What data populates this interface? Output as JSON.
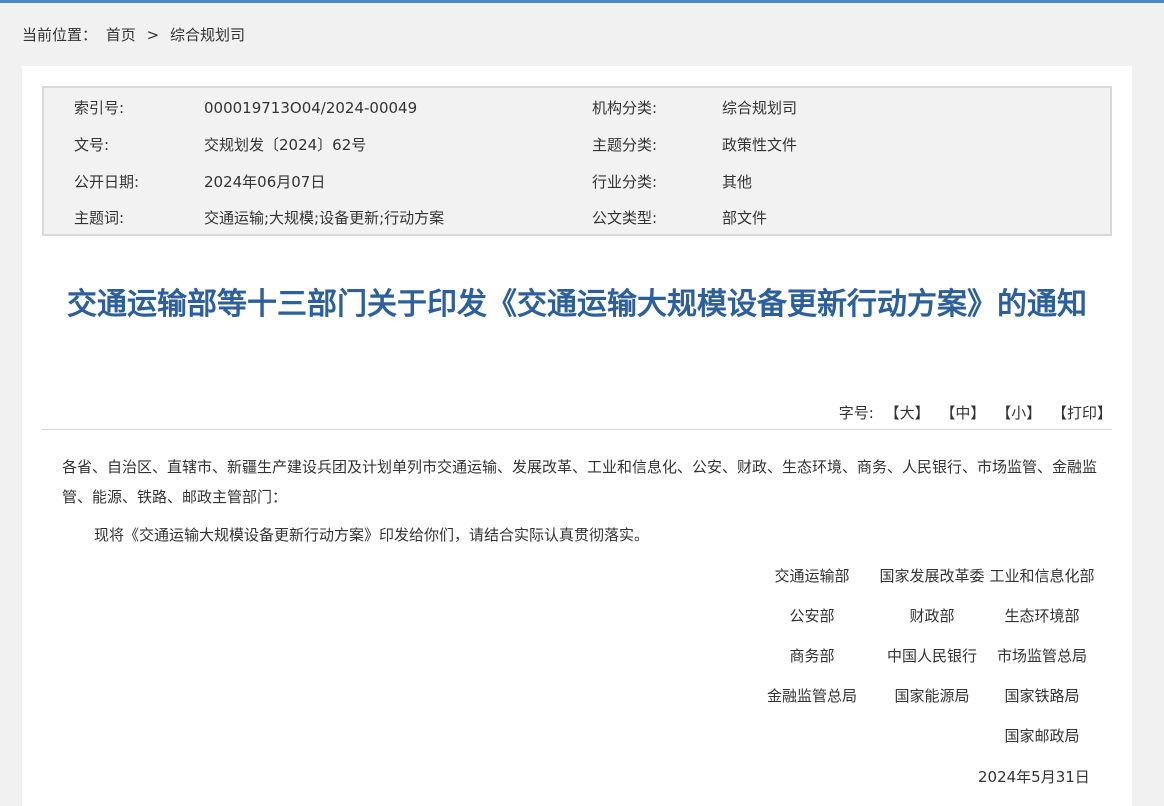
{
  "breadcrumb": {
    "prefix": "当前位置：",
    "home": "首页",
    "separator": ">",
    "current": "综合规划司"
  },
  "meta": {
    "rows": [
      {
        "k1": "索引号:",
        "v1": "000019713O04/2024-00049",
        "k2": "机构分类:",
        "v2": "综合规划司"
      },
      {
        "k1": "文号:",
        "v1": "交规划发〔2024〕62号",
        "k2": "主题分类:",
        "v2": "政策性文件"
      },
      {
        "k1": "公开日期:",
        "v1": "2024年06月07日",
        "k2": "行业分类:",
        "v2": "其他"
      },
      {
        "k1": "主题词:",
        "v1": "交通运输;大规模;设备更新;行动方案",
        "k2": "公文类型:",
        "v2": "部文件"
      }
    ]
  },
  "title": "交通运输部等十三部门关于印发《交通运输大规模设备更新行动方案》的通知",
  "font_size": {
    "label": "字号:",
    "large": "【大】",
    "medium": "【中】",
    "small": "【小】",
    "print": "【打印】"
  },
  "body": {
    "salutation": "各省、自治区、直辖市、新疆生产建设兵团及计划单列市交通运输、发展改革、工业和信息化、公安、财政、生态环境、商务、人民银行、市场监管、金融监管、能源、铁路、邮政主管部门：",
    "paragraph": "现将《交通运输大规模设备更新行动方案》印发给你们，请结合实际认真贯彻落实。"
  },
  "signers": [
    [
      "交通运输部",
      "国家发展改革委",
      "工业和信息化部"
    ],
    [
      "公安部",
      "财政部",
      "生态环境部"
    ],
    [
      "商务部",
      "中国人民银行",
      "市场监管总局"
    ],
    [
      "金融监管总局",
      "国家能源局",
      "国家铁路局"
    ],
    [
      "",
      "",
      "国家邮政局"
    ]
  ],
  "date": "2024年5月31日",
  "colors": {
    "title": "#2c5f9e",
    "topbar": "#4a86c8",
    "meta_bg": "#f2f2f2"
  }
}
